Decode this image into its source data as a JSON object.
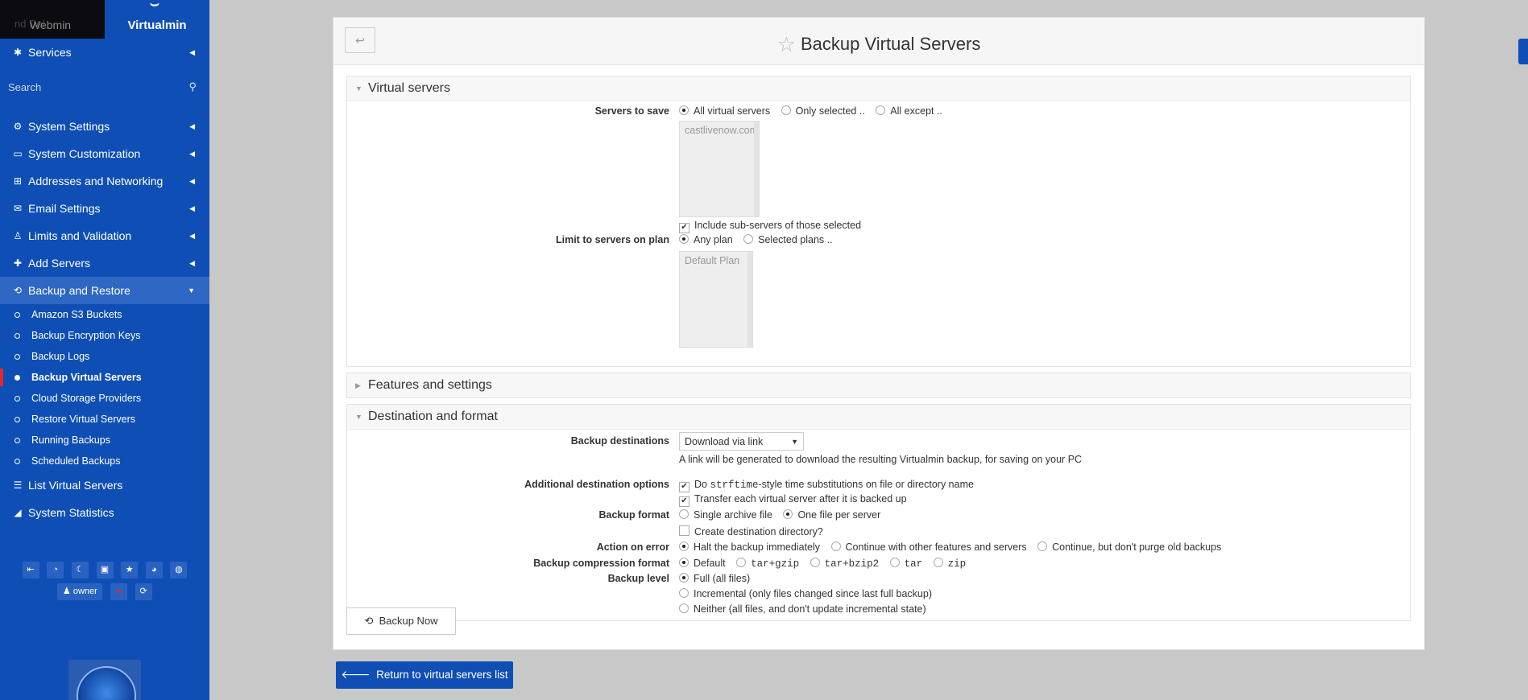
{
  "sidebar": {
    "tab_webmin": "Webmin",
    "tab_webmin_ghost": "nd Del",
    "tab_virtualmin": "Virtualmin",
    "services": "Services",
    "search_placeholder": "Search",
    "items": [
      {
        "label": "System Settings",
        "icon": "gear-icon"
      },
      {
        "label": "System Customization",
        "icon": "laptop-icon"
      },
      {
        "label": "Addresses and Networking",
        "icon": "network-icon"
      },
      {
        "label": "Email Settings",
        "icon": "envelope-icon"
      },
      {
        "label": "Limits and Validation",
        "icon": "user-check-icon"
      },
      {
        "label": "Add Servers",
        "icon": "plus-icon"
      },
      {
        "label": "Backup and Restore",
        "icon": "history-icon"
      }
    ],
    "subitems": [
      "Amazon S3 Buckets",
      "Backup Encryption Keys",
      "Backup Logs",
      "Backup Virtual Servers",
      "Cloud Storage Providers",
      "Restore Virtual Servers",
      "Running Backups",
      "Scheduled Backups"
    ],
    "list_virtual_servers": "List Virtual Servers",
    "system_statistics": "System Statistics",
    "owner_label": "owner"
  },
  "page": {
    "title": "Backup Virtual Servers",
    "back_symbol": "↩"
  },
  "sections": {
    "virtual_servers": "Virtual servers",
    "features": "Features and settings",
    "destination": "Destination and format"
  },
  "form": {
    "servers_to_save_label": "Servers to save",
    "servers_options": [
      "All virtual servers",
      "Only selected ..",
      "All except .."
    ],
    "servers_list": [
      "castlivenow.com"
    ],
    "include_sub": "Include sub-servers of those selected",
    "limit_plan_label": "Limit to servers on plan",
    "plan_options": [
      "Any plan",
      "Selected plans .."
    ],
    "plans_list": [
      "Default Plan"
    ],
    "backup_destinations_label": "Backup destinations",
    "backup_destinations_value": "Download via link",
    "destination_note": "A link will be generated to download the resulting Virtualmin backup, for saving on your PC",
    "additional_label": "Additional destination options",
    "strftime_pre": "Do ",
    "strftime_code": "strftime",
    "strftime_post": "-style time substitutions on file or directory name",
    "transfer_each": "Transfer each virtual server after it is backed up",
    "format_label": "Backup format",
    "format_options": [
      "Single archive file",
      "One file per server"
    ],
    "create_dir": "Create destination directory?",
    "action_error_label": "Action on error",
    "action_options": [
      "Halt the backup immediately",
      "Continue with other features and servers",
      "Continue, but don't purge old backups"
    ],
    "compression_label": "Backup compression format",
    "compression_options": [
      "Default",
      "tar+gzip",
      "tar+bzip2",
      "tar",
      "zip"
    ],
    "level_label": "Backup level",
    "level_options": [
      "Full (all files)",
      "Incremental (only files changed since last full backup)",
      "Neither (all files, and don't update incremental state)"
    ]
  },
  "buttons": {
    "backup_now": "Backup Now",
    "return": "Return to virtual servers list"
  }
}
